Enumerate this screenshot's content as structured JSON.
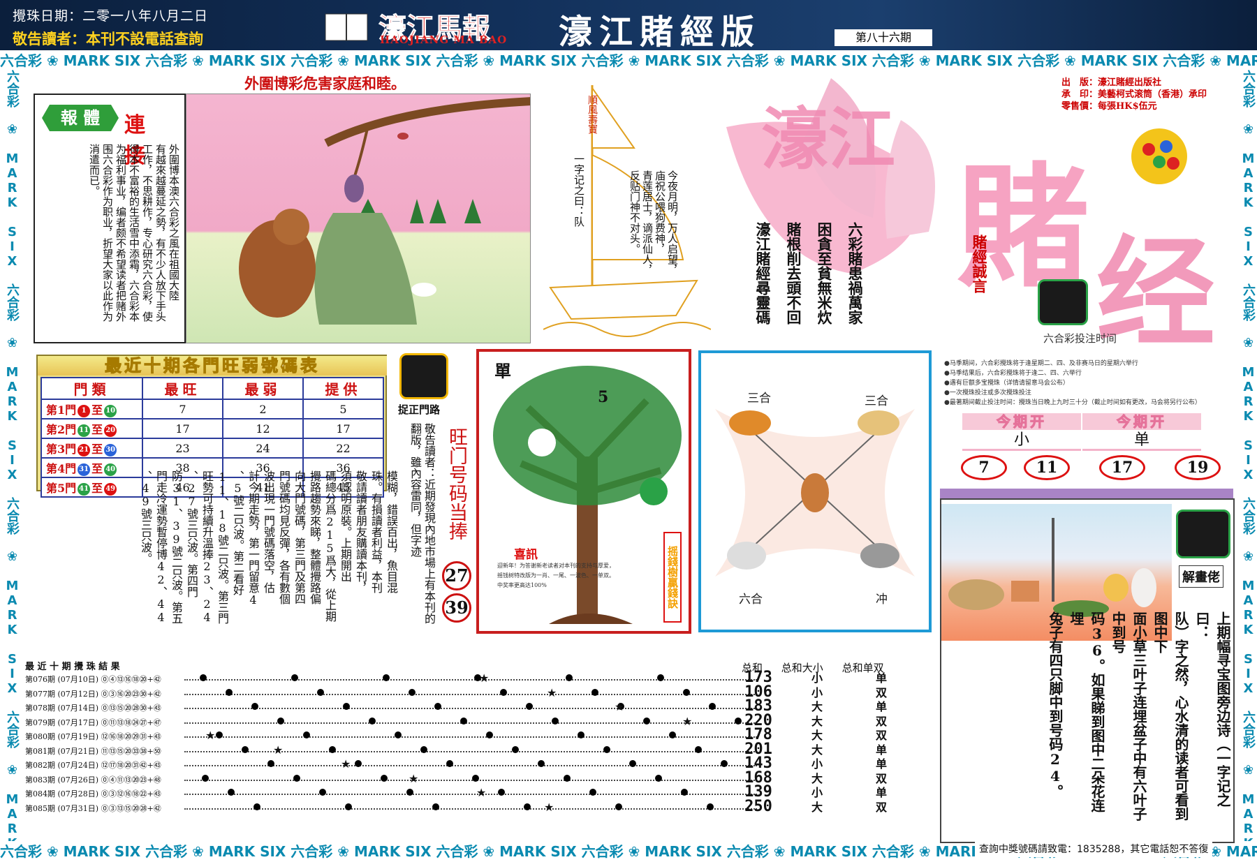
{
  "header": {
    "date": "攪珠日期：二零一八年八月二日",
    "notice": "敬告讀者：本刊不設電話查詢",
    "logo_cn": "濠江馬報",
    "logo_en": "HAOJIANG MA BAO",
    "edition": "濠江賭經版",
    "issue": "第八十六期"
  },
  "border_text": "六合彩 ❀ MARK SIX ",
  "warning_title": "外圍博彩危害家庭和睦。",
  "link_box": {
    "badge_green": "報 體",
    "badge_red": "連 接",
    "text_columns": [
      "外圍博本澳六合彩之風在祖國大陸",
      "有越來越蔓延之勢，有不少人放下手头",
      "工作，不思耕作，专心研究六合彩，使",
      "得本不富裕的生活雪中添霜，六合彩本",
      "为福利事业，编者颇不希望读者把赌外",
      "围六合彩作为职业，折望大家以此作为",
      "消遣而已。"
    ]
  },
  "boat": {
    "sail_text": "順風壽寶",
    "poem_title": "一字记之曰：队",
    "poem_lines": [
      "今夜月明，万人启望，",
      "庙祝公喂狗费神，",
      "青莲居士，谪派仙人，",
      "反贴门神不对头。"
    ]
  },
  "title_block": {
    "big_title_1": "濠江",
    "big_title_2": "賭",
    "big_title_3": "经",
    "publisher_lines": [
      "出　版：濠江賭經出版社",
      "承　印：美藝柯式滚筒（香港）承印",
      "零售價：每張HK$伍元"
    ],
    "caution": "賭經誠言",
    "verses": [
      "六彩賭患禍萬家",
      "困貪至貧無米炊",
      "賭根削去頭不回",
      "濠江賭經尋靈碼"
    ],
    "lottery_time_label": "六合彩投注时间"
  },
  "hot_table": {
    "title": "最近十期各門旺弱號碼表",
    "headers": [
      "門類",
      "最旺",
      "最弱",
      "提供"
    ],
    "rows": [
      {
        "door": "第1門",
        "from": "1",
        "to": "10",
        "max": "7",
        "min": "2",
        "offer": "5"
      },
      {
        "door": "第2門",
        "from": "11",
        "to": "20",
        "max": "17",
        "min": "12",
        "offer": "17"
      },
      {
        "door": "第3門",
        "from": "21",
        "to": "30",
        "max": "23",
        "min": "24",
        "offer": "22"
      },
      {
        "door": "第4門",
        "from": "31",
        "to": "40",
        "max": "38",
        "min": "36",
        "offer": "36"
      },
      {
        "door": "第5門",
        "from": "41",
        "to": "49",
        "max": "46",
        "min": "41",
        "offer": "45"
      }
    ],
    "to_word": "至"
  },
  "tool_label": "捉正門路",
  "notice_column": "敬告讀者：近期發現內地市場上有本刊的翻版，雖內容雷同，但字迹",
  "wang": {
    "title": "旺门号码当捧",
    "numbers": [
      "27",
      "39"
    ]
  },
  "body_columns": [
    "模糊，錯誤百出，魚目混",
    "珠。有損讀者利益，本刊",
    "敬請讀者朋友購讀本刊，",
    "須認明原裝。上期開出",
    "碼總分爲215爲大，從上期",
    "攪路趨勢來睇，整體攪路偏",
    "向大門號碼，第三門及第四",
    "門號碼均見反彈，各有數個",
    "波出現一門號碼落空，估",
    "計今期走勢，第一門留意4",
    "、5號二只波。第二看好",
    "11、18號二只波。第三門",
    "旺勢可持續升溫捧23、24",
    "、27號三只波。第四門",
    "防31、39號二只波。第五",
    "門走冷運勢暫停博42、44",
    "、49號三只波。"
  ],
  "tree": {
    "label_single": "單",
    "label_five": "5",
    "xi_title": "喜訊",
    "xi_text": "迎新年！为答谢新老读者对本刊的支持与厚爱，摇钱树特改版为一肖、一尾、一波色、一单双。中奖率更高达100%",
    "side_text": "摇錢樹贏錢訣"
  },
  "zodiac": {
    "labels": [
      "三合",
      "三合",
      "六合",
      "冲"
    ]
  },
  "rules_lines": [
    "●马季期间，六合彩攪珠将于逢星期二、四、及非赛马日的星期六举行",
    "●马季结果后，六合彩攪珠将于逢二、四、六举行",
    "●遇有巨额多宝攪珠（详情请留意马会公布）",
    "●一次攪珠投注或多次攪珠投注",
    "●最著期间截止投注时间：攪珠当日晚上九时三十分（截止时间如有更改，马会将另行公布）"
  ],
  "open": {
    "head": "今期开",
    "values": [
      "小",
      "单"
    ],
    "numbers": [
      "7",
      "11",
      "17",
      "19"
    ]
  },
  "rabbit": {
    "label": "解畫佬",
    "text_columns": [
      "上期幅寻宝图旁边诗（一字记之曰：",
      "队）字之然，心水清的读者可看到图中下",
      "面小草三叶子连埋盆子中有六叶子中到号",
      "码36。如果睇到图中二朵花连埋",
      "兔子有四只脚中到号码24。"
    ]
  },
  "results": {
    "header_label": "最 近 十 期 攪 珠 結 果",
    "sum_head": [
      "总和",
      "总和大小",
      "总和单双"
    ],
    "rows": [
      {
        "label": "第076期 (07月10日) ⓪④⑬⑯⑱⑳+㊷",
        "sum": "173",
        "size": "小",
        "oe": "单"
      },
      {
        "label": "第077期 (07月12日) ⓪③⑯⑳㉓㉚+㊷",
        "sum": "106",
        "size": "小",
        "oe": "双"
      },
      {
        "label": "第078期 (07月14日) ⓪⑬⑮⑳㉘㉚+㊸",
        "sum": "183",
        "size": "大",
        "oe": "单"
      },
      {
        "label": "第079期 (07月17日) ⓪⑪⑬⑱㉔㉗+㊼",
        "sum": "220",
        "size": "大",
        "oe": "双"
      },
      {
        "label": "第080期 (07月19日) ⑫⑯⑱⑳㉙㉛+㊸",
        "sum": "178",
        "size": "大",
        "oe": "双"
      },
      {
        "label": "第081期 (07月21日) ⑪⑬⑮⑳㉝㊳+㊿",
        "sum": "201",
        "size": "大",
        "oe": "单"
      },
      {
        "label": "第082期 (07月24日) ⑫⑰⑱⑳㉛㊷+㊸",
        "sum": "143",
        "size": "小",
        "oe": "单"
      },
      {
        "label": "第083期 (07月26日) ⓪④⑪⑬⑳㉓+㊽",
        "sum": "168",
        "size": "大",
        "oe": "双"
      },
      {
        "label": "第084期 (07月28日) ⓪③⑫⑯⑱㉒+㊸",
        "sum": "139",
        "size": "小",
        "oe": "单"
      },
      {
        "label": "第085期 (07月31日) ⓪③⑬⑮⑳㉘+㊷",
        "sum": "250",
        "size": "大",
        "oe": "双"
      }
    ]
  },
  "footer_note": "查詢中獎號碼請致電：1835288，其它電話恕不答復"
}
